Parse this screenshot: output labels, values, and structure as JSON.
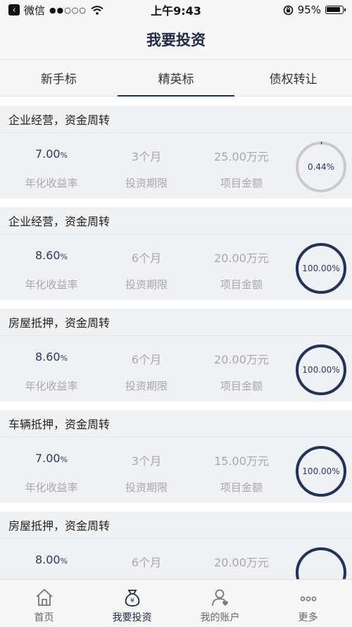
{
  "status_bar": {
    "app": "微信",
    "signal": "●●○○○",
    "time": "上午9:43",
    "battery": "95%"
  },
  "nav": {
    "title": "我要投资"
  },
  "tabs": [
    {
      "label": "新手标",
      "active": false
    },
    {
      "label": "精英标",
      "active": true
    },
    {
      "label": "债权转让",
      "active": false
    }
  ],
  "labels": {
    "rate": "年化收益率",
    "term": "投资期限",
    "amount": "项目金额"
  },
  "products": [
    {
      "title": "企业经营，资金周转",
      "rate": "7.00",
      "rate_unit": "%",
      "term": "3个月",
      "amount": "25.00万元",
      "progress_label": "0.44%",
      "progress": 0.0044
    },
    {
      "title": "企业经营，资金周转",
      "rate": "8.60",
      "rate_unit": "%",
      "term": "6个月",
      "amount": "20.00万元",
      "progress_label": "100.00%",
      "progress": 1.0
    },
    {
      "title": "房屋抵押，资金周转",
      "rate": "8.60",
      "rate_unit": "%",
      "term": "6个月",
      "amount": "20.00万元",
      "progress_label": "100.00%",
      "progress": 1.0
    },
    {
      "title": "车辆抵押，资金周转",
      "rate": "7.00",
      "rate_unit": "%",
      "term": "3个月",
      "amount": "15.00万元",
      "progress_label": "100.00%",
      "progress": 1.0
    },
    {
      "title": "房屋抵押，资金周转",
      "rate": "8.00",
      "rate_unit": "%",
      "term": "6个月",
      "amount": "20.00万元",
      "progress_label": "",
      "progress": 1.0
    }
  ],
  "bottom_nav": [
    {
      "label": "首页",
      "icon": "home-icon",
      "active": false
    },
    {
      "label": "我要投资",
      "icon": "money-bag-icon",
      "active": true
    },
    {
      "label": "我的账户",
      "icon": "user-icon",
      "active": false
    },
    {
      "label": "更多",
      "icon": "more-icon",
      "active": false
    }
  ],
  "colors": {
    "accent": "#23325a",
    "ring_track": "#c9cacc",
    "muted": "#a8a8ab"
  }
}
